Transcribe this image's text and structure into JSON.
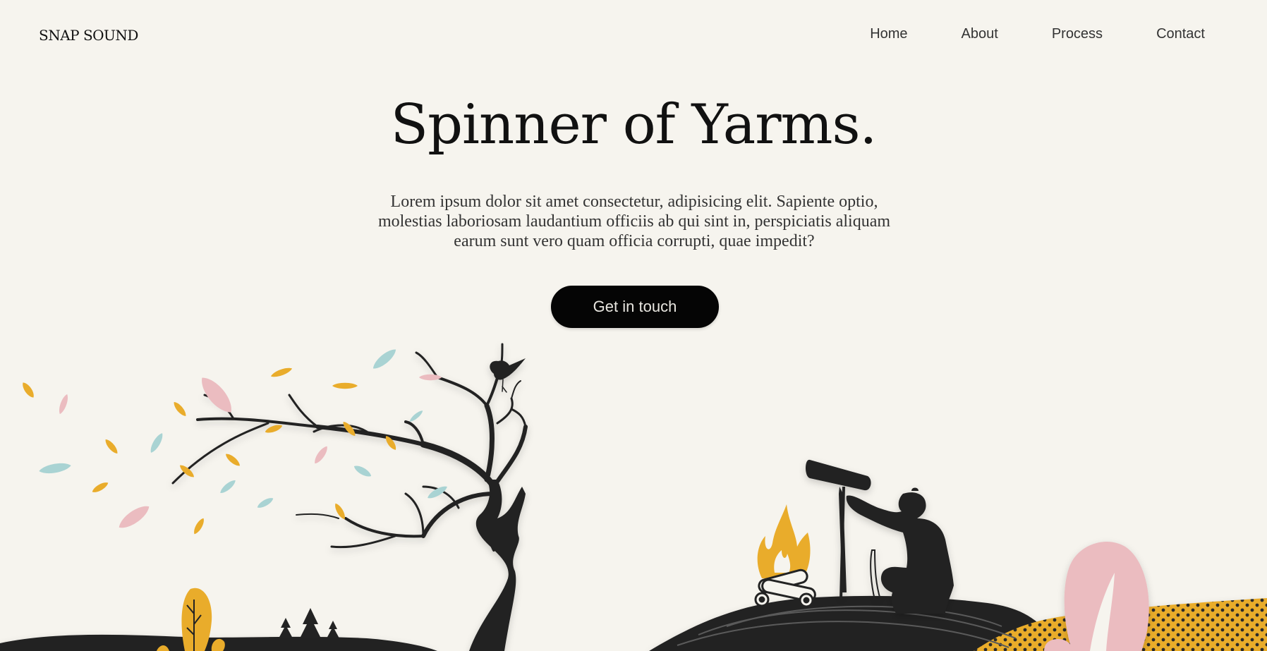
{
  "nav": {
    "logo": "SNAP SOUND",
    "links": [
      "Home",
      "About",
      "Process",
      "Contact"
    ]
  },
  "hero": {
    "title": "Spinner of Yarms.",
    "description": "Lorem ipsum dolor sit amet consectetur, adipisicing elit. Sapiente optio, molestias laboriosam laudantium officiis ab qui sint in, perspiciatis aliquam earum sunt vero quam officia corrupti, quae impedit?",
    "cta_label": "Get in touch"
  },
  "colors": {
    "background": "#f6f4ee",
    "ink": "#232323",
    "mustard": "#e9ac2b",
    "pink": "#ebbcc0",
    "teal": "#a9d3d3"
  }
}
